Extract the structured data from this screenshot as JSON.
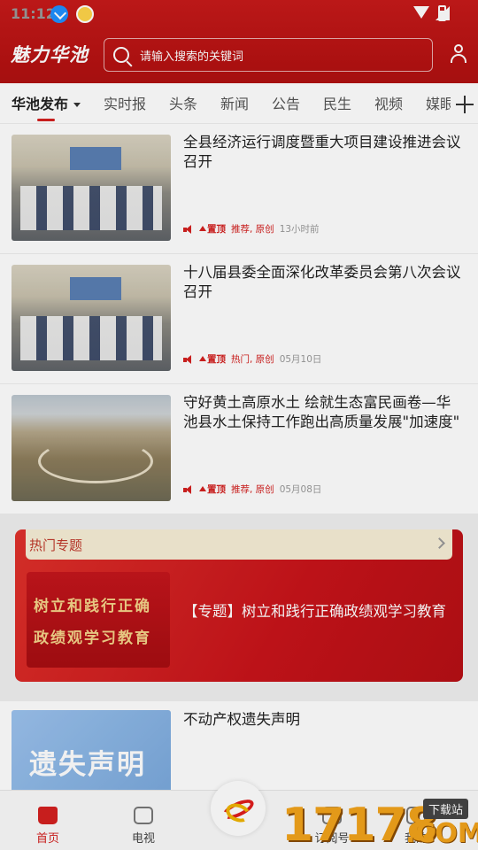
{
  "status_bar": {
    "time": "11:12"
  },
  "header": {
    "logo": "魅力华池",
    "search_placeholder": "请输入搜索的关键词"
  },
  "tabs": [
    {
      "label": "华池发布",
      "active": true
    },
    {
      "label": "实时报"
    },
    {
      "label": "头条"
    },
    {
      "label": "新闻"
    },
    {
      "label": "公告"
    },
    {
      "label": "民生"
    },
    {
      "label": "视频"
    },
    {
      "label": "媒眼"
    }
  ],
  "articles": [
    {
      "title": "全县经济运行调度暨重大项目建设推进会议召开",
      "pin": "置顶",
      "tags": "推荐, 原创",
      "time": "13小时前"
    },
    {
      "title": "十八届县委全面深化改革委员会第八次会议召开",
      "pin": "置顶",
      "tags": "热门, 原创",
      "time": "05月10日"
    },
    {
      "title": "守好黄土高原水土 绘就生态富民画卷—华池县水土保持工作跑出高质量发展\"加速度\"",
      "pin": "置顶",
      "tags": "推荐, 原创",
      "time": "05月08日"
    }
  ],
  "topic": {
    "header": "热门专题",
    "image_line1": "树立和践行正确",
    "image_line2": "政绩观学习教育",
    "title": "【专题】树立和践行正确政绩观学习教育"
  },
  "article4": {
    "title": "不动产权遗失声明",
    "image_text": "遗失声明"
  },
  "bottom_nav": {
    "home": "首页",
    "tv": "电视",
    "subscribe": "订阅号",
    "me": "我的"
  },
  "watermark": {
    "number": "17178",
    "suffix": ".COM",
    "tag": "下载站"
  },
  "colors": {
    "brand_red": "#c71a1a",
    "accent": "#d4201f"
  }
}
